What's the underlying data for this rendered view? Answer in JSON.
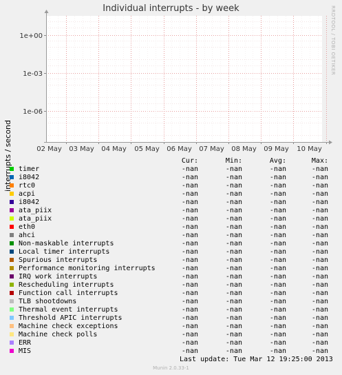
{
  "title": "Individual interrupts - by week",
  "side_note": "RRDTOOL / TOBI OETIKER",
  "footer": "Munin 2.0.33-1",
  "last_update": "Last update:  Tue Mar 12 19:25:00 2013",
  "legend_headers": {
    "cur": "Cur:",
    "min": "Min:",
    "avg": "Avg:",
    "max": "Max:"
  },
  "legend": [
    {
      "name": "timer",
      "color": "#00cc00",
      "cur": "-nan",
      "min": "-nan",
      "avg": "-nan",
      "max": "-nan"
    },
    {
      "name": "i8042",
      "color": "#0066b3",
      "cur": "-nan",
      "min": "-nan",
      "avg": "-nan",
      "max": "-nan"
    },
    {
      "name": "rtc0",
      "color": "#ff8000",
      "cur": "-nan",
      "min": "-nan",
      "avg": "-nan",
      "max": "-nan"
    },
    {
      "name": "acpi",
      "color": "#ffcc00",
      "cur": "-nan",
      "min": "-nan",
      "avg": "-nan",
      "max": "-nan"
    },
    {
      "name": "i8042",
      "color": "#330099",
      "cur": "-nan",
      "min": "-nan",
      "avg": "-nan",
      "max": "-nan"
    },
    {
      "name": "ata_piix",
      "color": "#990099",
      "cur": "-nan",
      "min": "-nan",
      "avg": "-nan",
      "max": "-nan"
    },
    {
      "name": "ata_piix",
      "color": "#ccff00",
      "cur": "-nan",
      "min": "-nan",
      "avg": "-nan",
      "max": "-nan"
    },
    {
      "name": "eth0",
      "color": "#ff0000",
      "cur": "-nan",
      "min": "-nan",
      "avg": "-nan",
      "max": "-nan"
    },
    {
      "name": "ahci",
      "color": "#808080",
      "cur": "-nan",
      "min": "-nan",
      "avg": "-nan",
      "max": "-nan"
    },
    {
      "name": "Non-maskable interrupts",
      "color": "#008f00",
      "cur": "-nan",
      "min": "-nan",
      "avg": "-nan",
      "max": "-nan"
    },
    {
      "name": "Local timer interrupts",
      "color": "#00487d",
      "cur": "-nan",
      "min": "-nan",
      "avg": "-nan",
      "max": "-nan"
    },
    {
      "name": "Spurious interrupts",
      "color": "#b35a00",
      "cur": "-nan",
      "min": "-nan",
      "avg": "-nan",
      "max": "-nan"
    },
    {
      "name": "Performance monitoring interrupts",
      "color": "#b38f00",
      "cur": "-nan",
      "min": "-nan",
      "avg": "-nan",
      "max": "-nan"
    },
    {
      "name": "IRQ work interrupts",
      "color": "#6b006b",
      "cur": "-nan",
      "min": "-nan",
      "avg": "-nan",
      "max": "-nan"
    },
    {
      "name": "Rescheduling interrupts",
      "color": "#8fb300",
      "cur": "-nan",
      "min": "-nan",
      "avg": "-nan",
      "max": "-nan"
    },
    {
      "name": "Function call interrupts",
      "color": "#b30000",
      "cur": "-nan",
      "min": "-nan",
      "avg": "-nan",
      "max": "-nan"
    },
    {
      "name": "TLB shootdowns",
      "color": "#bebebe",
      "cur": "-nan",
      "min": "-nan",
      "avg": "-nan",
      "max": "-nan"
    },
    {
      "name": "Thermal event interrupts",
      "color": "#80ff80",
      "cur": "-nan",
      "min": "-nan",
      "avg": "-nan",
      "max": "-nan"
    },
    {
      "name": "Threshold APIC interrupts",
      "color": "#80c9ff",
      "cur": "-nan",
      "min": "-nan",
      "avg": "-nan",
      "max": "-nan"
    },
    {
      "name": "Machine check exceptions",
      "color": "#ffc080",
      "cur": "-nan",
      "min": "-nan",
      "avg": "-nan",
      "max": "-nan"
    },
    {
      "name": "Machine check polls",
      "color": "#ffe680",
      "cur": "-nan",
      "min": "-nan",
      "avg": "-nan",
      "max": "-nan"
    },
    {
      "name": "ERR",
      "color": "#aa80ff",
      "cur": "-nan",
      "min": "-nan",
      "avg": "-nan",
      "max": "-nan"
    },
    {
      "name": "MIS",
      "color": "#ee00cc",
      "cur": "-nan",
      "min": "-nan",
      "avg": "-nan",
      "max": "-nan"
    }
  ],
  "chart_data": {
    "type": "line",
    "title": "Individual interrupts - by week",
    "ylabel": "interrupts / second",
    "xlabel": "",
    "y_scale": "log",
    "y_ticks": [
      "1e+00",
      "1e-03",
      "1e-06"
    ],
    "x_ticks": [
      "02 May",
      "03 May",
      "04 May",
      "05 May",
      "06 May",
      "07 May",
      "08 May",
      "09 May",
      "10 May"
    ],
    "grid": true,
    "series": []
  }
}
